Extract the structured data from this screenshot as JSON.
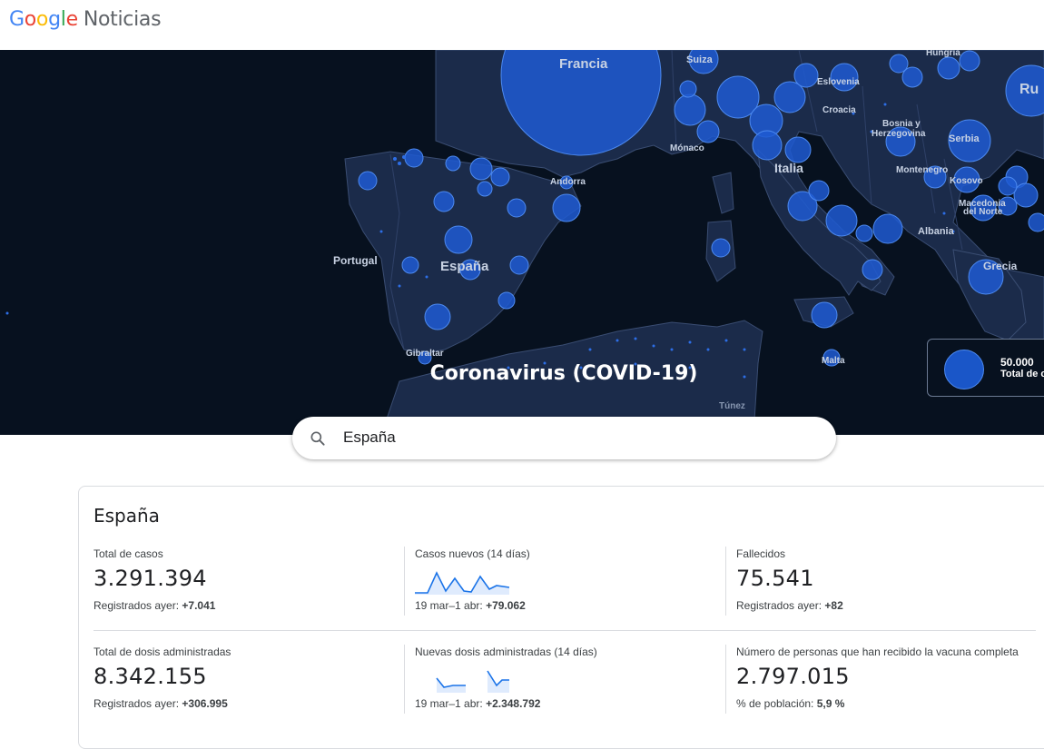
{
  "header": {
    "brand_letters": [
      {
        "ch": "G",
        "color": "#4285F4"
      },
      {
        "ch": "o",
        "color": "#EA4335"
      },
      {
        "ch": "o",
        "color": "#FBBC05"
      },
      {
        "ch": "g",
        "color": "#4285F4"
      },
      {
        "ch": "l",
        "color": "#34A853"
      },
      {
        "ch": "e",
        "color": "#EA4335"
      }
    ],
    "product": "Noticias"
  },
  "hero": {
    "title": "Coronavirus (COVID-19)",
    "map_labels": [
      "Francia",
      "Suiza",
      "Eslovenia",
      "Hungría",
      "Croacia",
      "Bosnia y",
      "Herzegovina",
      "Serbia",
      "Mónaco",
      "Andorra",
      "Italia",
      "Montenegro",
      "Kosovo",
      "Macedonia",
      "del Norte",
      "Albania",
      "Grecia",
      "Portugal",
      "España",
      "Gibraltar",
      "Malta",
      "Túnez",
      "Ru"
    ],
    "legend": {
      "value": "50.000",
      "caption": "Total de c"
    }
  },
  "search": {
    "value": "España",
    "icon": "search-icon"
  },
  "region": {
    "name": "España",
    "stats": [
      {
        "label": "Total de casos",
        "value": "3.291.394",
        "sub_label": "Registrados ayer:",
        "sub_value": "+7.041"
      },
      {
        "label": "Casos nuevos (14 días)",
        "value": "",
        "sub_label": "19 mar–1 abr:",
        "sub_value": "+79.062",
        "spark": "cases"
      },
      {
        "label": "Fallecidos",
        "value": "75.541",
        "sub_label": "Registrados ayer:",
        "sub_value": "+82"
      },
      {
        "label": "Total de dosis administradas",
        "value": "8.342.155",
        "sub_label": "Registrados ayer:",
        "sub_value": "+306.995"
      },
      {
        "label": "Nuevas dosis administradas (14 días)",
        "value": "",
        "sub_label": "19 mar–1 abr:",
        "sub_value": "+2.348.792",
        "spark": "doses"
      },
      {
        "label": "Número de personas que han recibido la vacuna completa",
        "value": "2.797.015",
        "sub_label": "% de población:",
        "sub_value": "5,9 %"
      }
    ]
  },
  "colors": {
    "accent": "#1a73e8",
    "map_land": "#1b2b4a",
    "map_sea": "#07111f",
    "bubble": "#1e5bd2"
  }
}
